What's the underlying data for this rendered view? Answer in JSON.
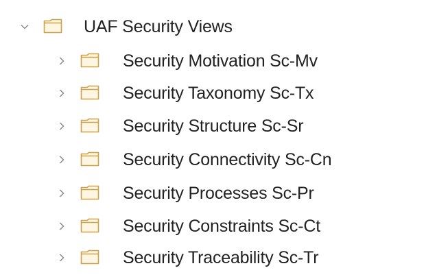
{
  "tree": {
    "root": {
      "label": "UAF Security Views",
      "expanded": true,
      "icon": "folder-icon",
      "chevron_icon": "chevron-down-icon"
    },
    "children": [
      {
        "label": "Security Motivation Sc-Mv",
        "icon": "folder-icon",
        "chevron_icon": "chevron-right-icon"
      },
      {
        "label": "Security Taxonomy Sc-Tx",
        "icon": "folder-icon",
        "chevron_icon": "chevron-right-icon"
      },
      {
        "label": "Security Structure Sc-Sr",
        "icon": "folder-icon",
        "chevron_icon": "chevron-right-icon"
      },
      {
        "label": "Security Connectivity Sc-Cn",
        "icon": "folder-icon",
        "chevron_icon": "chevron-right-icon"
      },
      {
        "label": "Security Processes Sc-Pr",
        "icon": "folder-icon",
        "chevron_icon": "chevron-right-icon"
      },
      {
        "label": "Security Constraints Sc-Ct",
        "icon": "folder-icon",
        "chevron_icon": "chevron-right-icon"
      },
      {
        "label": "Security Traceability Sc-Tr",
        "icon": "folder-icon",
        "chevron_icon": "chevron-right-icon"
      }
    ]
  },
  "colors": {
    "chevron": "#8a8a8a",
    "folder_stroke": "#c9a24a",
    "folder_fill": "#fdf6e3",
    "text": "#222222"
  }
}
